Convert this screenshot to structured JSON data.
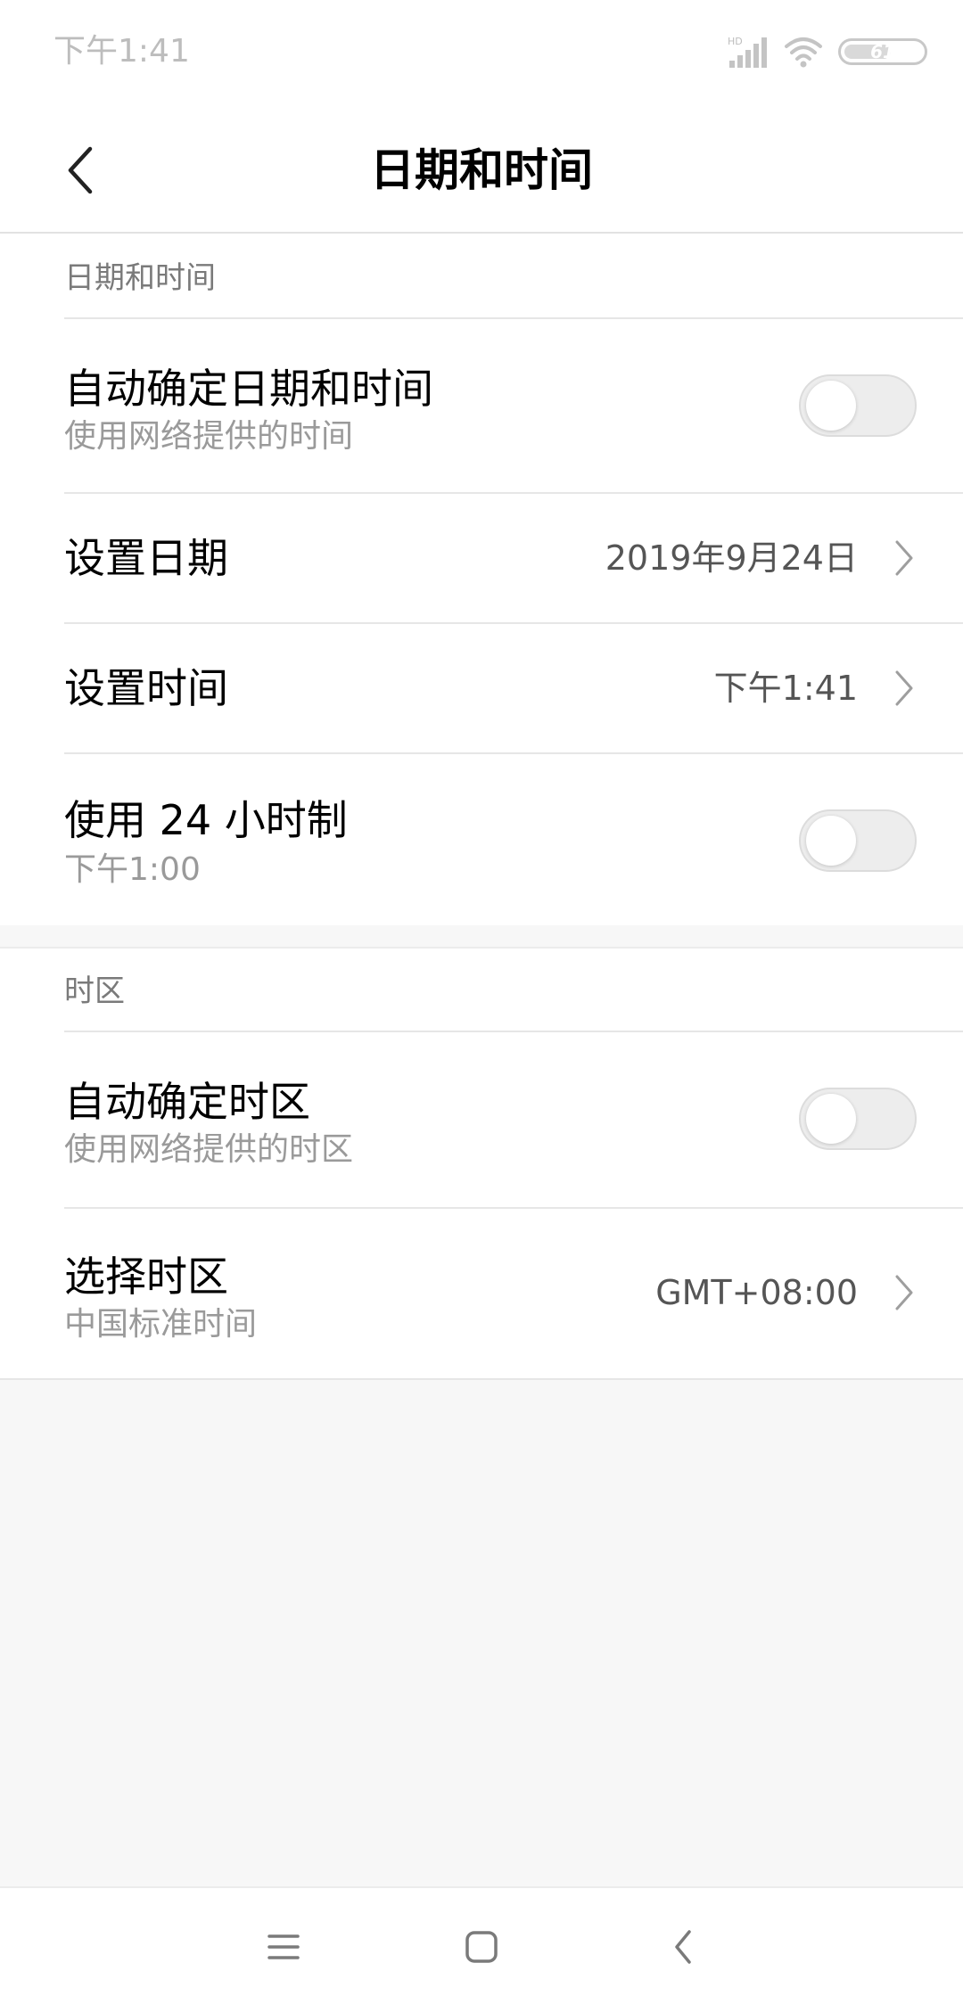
{
  "status_bar": {
    "time": "下午1:41",
    "network_badge": "HD",
    "battery_level": "61",
    "battery_fraction": 0.61,
    "icons": [
      "hd-signal-icon",
      "wifi-icon",
      "battery-icon"
    ]
  },
  "header": {
    "title": "日期和时间",
    "back_icon": "chevron-left-icon"
  },
  "section_datetime": {
    "header": "日期和时间",
    "items": [
      {
        "title": "自动确定日期和时间",
        "summary": "使用网络提供的时间",
        "control": "toggle",
        "checked": false
      },
      {
        "title": "设置日期",
        "value": "2019年9月24日",
        "control": "chevron"
      },
      {
        "title": "设置时间",
        "value": "下午1:41",
        "control": "chevron"
      },
      {
        "title": "使用 24 小时制",
        "summary": "下午1:00",
        "control": "toggle",
        "checked": false
      }
    ]
  },
  "section_timezone": {
    "header": "时区",
    "items": [
      {
        "title": "自动确定时区",
        "summary": "使用网络提供的时区",
        "control": "toggle",
        "checked": false
      },
      {
        "title": "选择时区",
        "summary": "中国标准时间",
        "value": "GMT+08:00",
        "control": "chevron"
      }
    ]
  },
  "nav_bar": {
    "icons": [
      "menu-icon",
      "home-icon",
      "back-icon"
    ]
  },
  "colors": {
    "background": "#f7f7f7",
    "surface": "#ffffff",
    "primary_text": "#000000",
    "secondary_text": "#9a9a9a",
    "toggle_off": "#ededed"
  }
}
